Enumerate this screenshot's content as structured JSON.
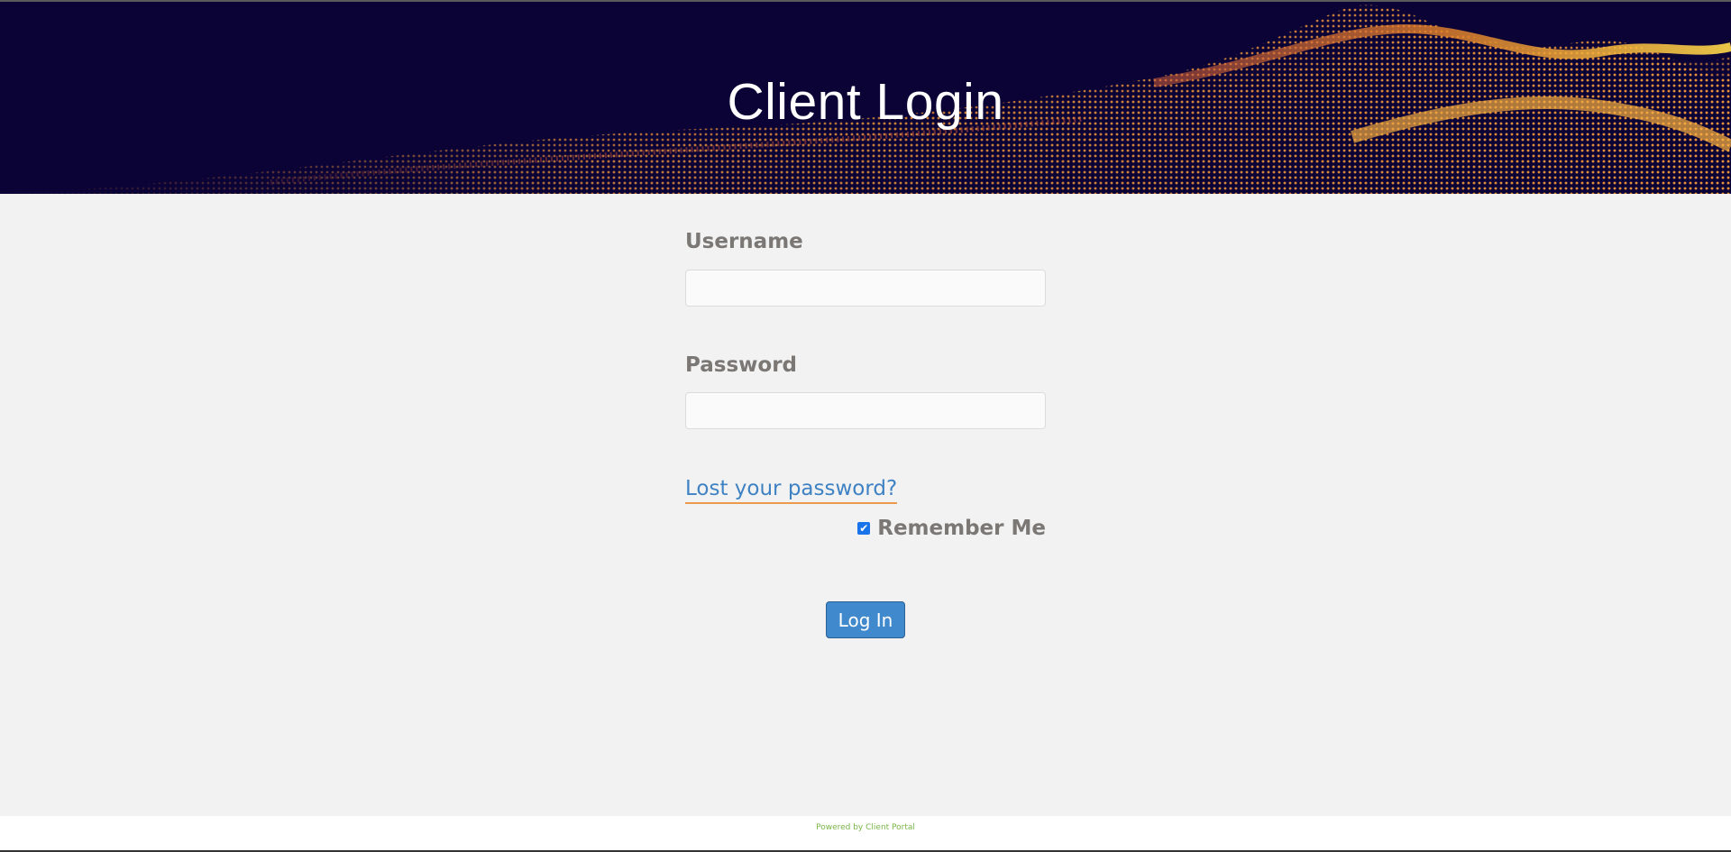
{
  "header": {
    "title": "Client Login"
  },
  "form": {
    "username_label": "Username",
    "username_value": "",
    "password_label": "Password",
    "password_value": "",
    "lost_password_link": "Lost your password?",
    "remember_me_label": "Remember Me",
    "remember_me_checked": true,
    "login_button": "Log In"
  },
  "footer": {
    "text": "Powered by Client Portal"
  },
  "colors": {
    "hero_background": "#0b0235",
    "link": "#3f82c4",
    "link_underline": "#e99a4d",
    "button": "#3f89cc",
    "footer_text": "#7ab648",
    "label": "#7a7774"
  }
}
